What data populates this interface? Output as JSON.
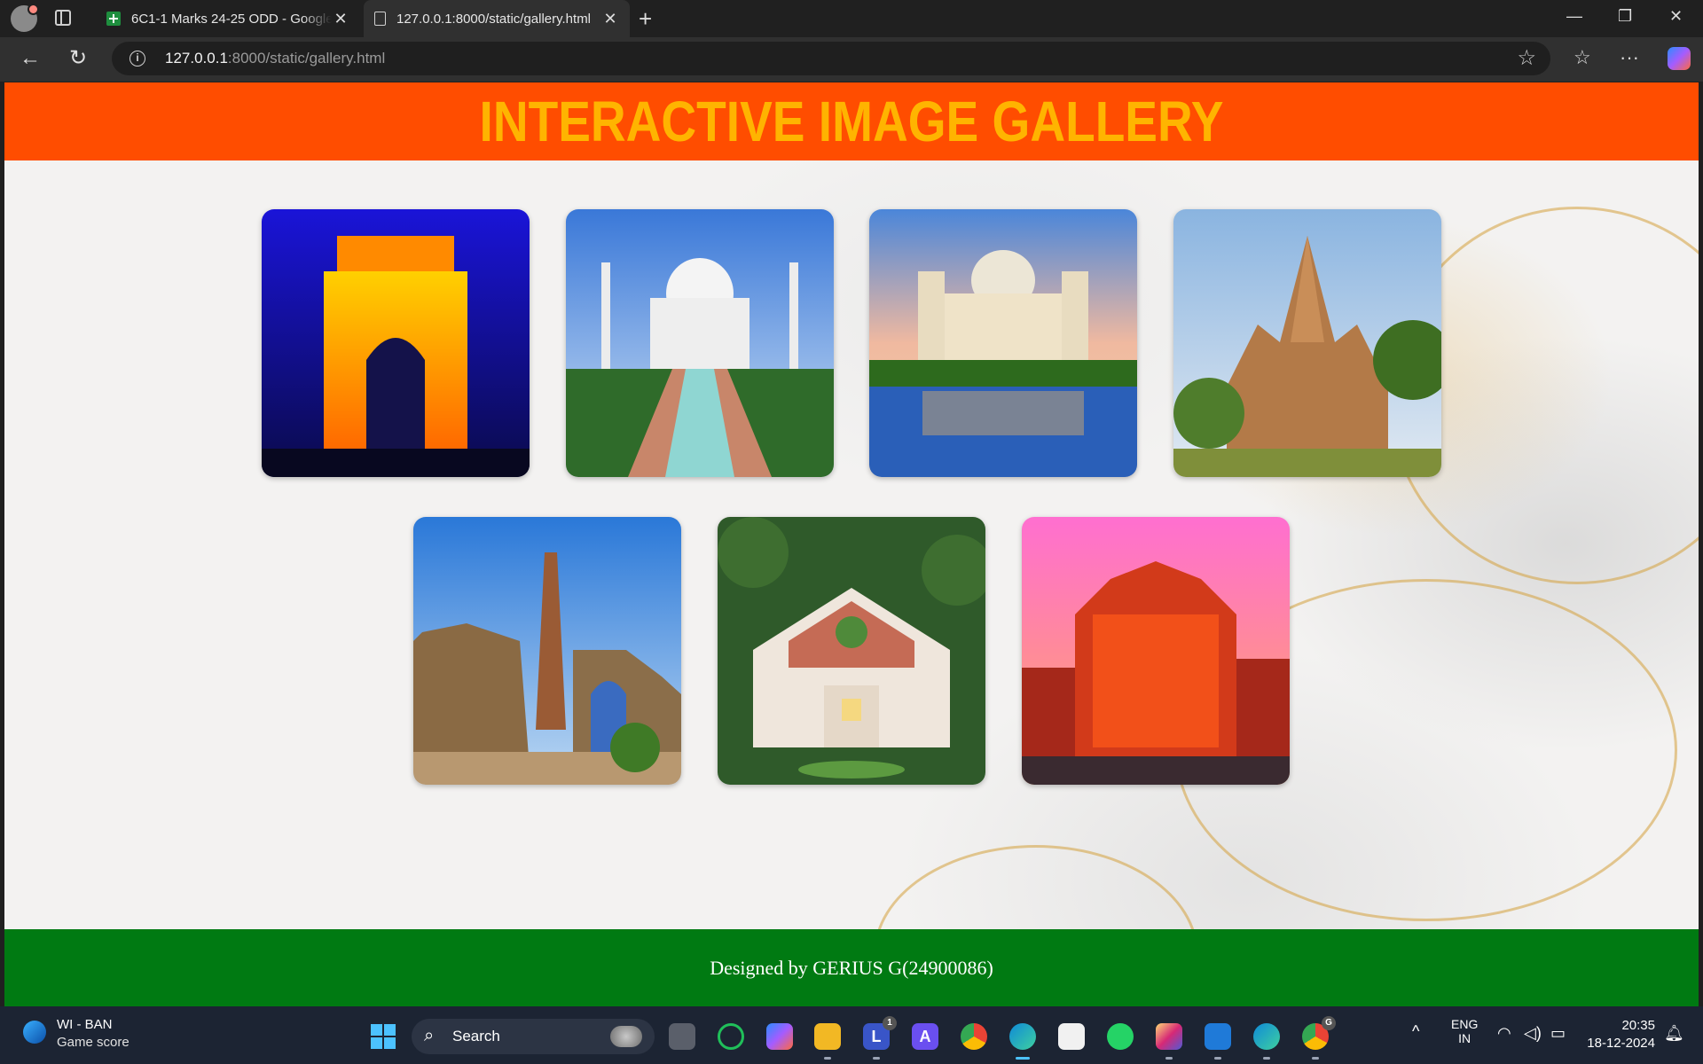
{
  "browser": {
    "tabs": [
      {
        "title": "6C1-1 Marks 24-25 ODD - Google",
        "icon": "sheets-icon"
      },
      {
        "title": "127.0.0.1:8000/static/gallery.html",
        "icon": "document-icon"
      }
    ],
    "url_host": "127.0.0.1",
    "url_path": ":8000/static/gallery.html"
  },
  "page": {
    "title": "INTERACTIVE IMAGE GALLERY",
    "footer": "Designed by GERIUS G(24900086)",
    "header_color": "#ff4d00",
    "title_color": "#ffb400",
    "footer_color": "#007a12",
    "gallery": [
      {
        "name": "gallery-image-india-gate",
        "subject": "India Gate at night"
      },
      {
        "name": "gallery-image-taj-mahal",
        "subject": "Taj Mahal"
      },
      {
        "name": "gallery-image-victoria-memorial",
        "subject": "Victoria Memorial"
      },
      {
        "name": "gallery-image-khajuraho-temple",
        "subject": "Khajuraho temple"
      },
      {
        "name": "gallery-image-qutub-minar",
        "subject": "Qutub Minar"
      },
      {
        "name": "gallery-image-parliament-house",
        "subject": "New Parliament House"
      },
      {
        "name": "gallery-image-hawa-mahal",
        "subject": "Hawa Mahal"
      }
    ]
  },
  "taskbar": {
    "weather_title": "WI - BAN",
    "weather_sub": "Game score",
    "search_label": "Search",
    "lang_top": "ENG",
    "lang_bottom": "IN",
    "time": "20:35",
    "date": "18-12-2024",
    "l_badge": "1",
    "g_badge": "G"
  }
}
